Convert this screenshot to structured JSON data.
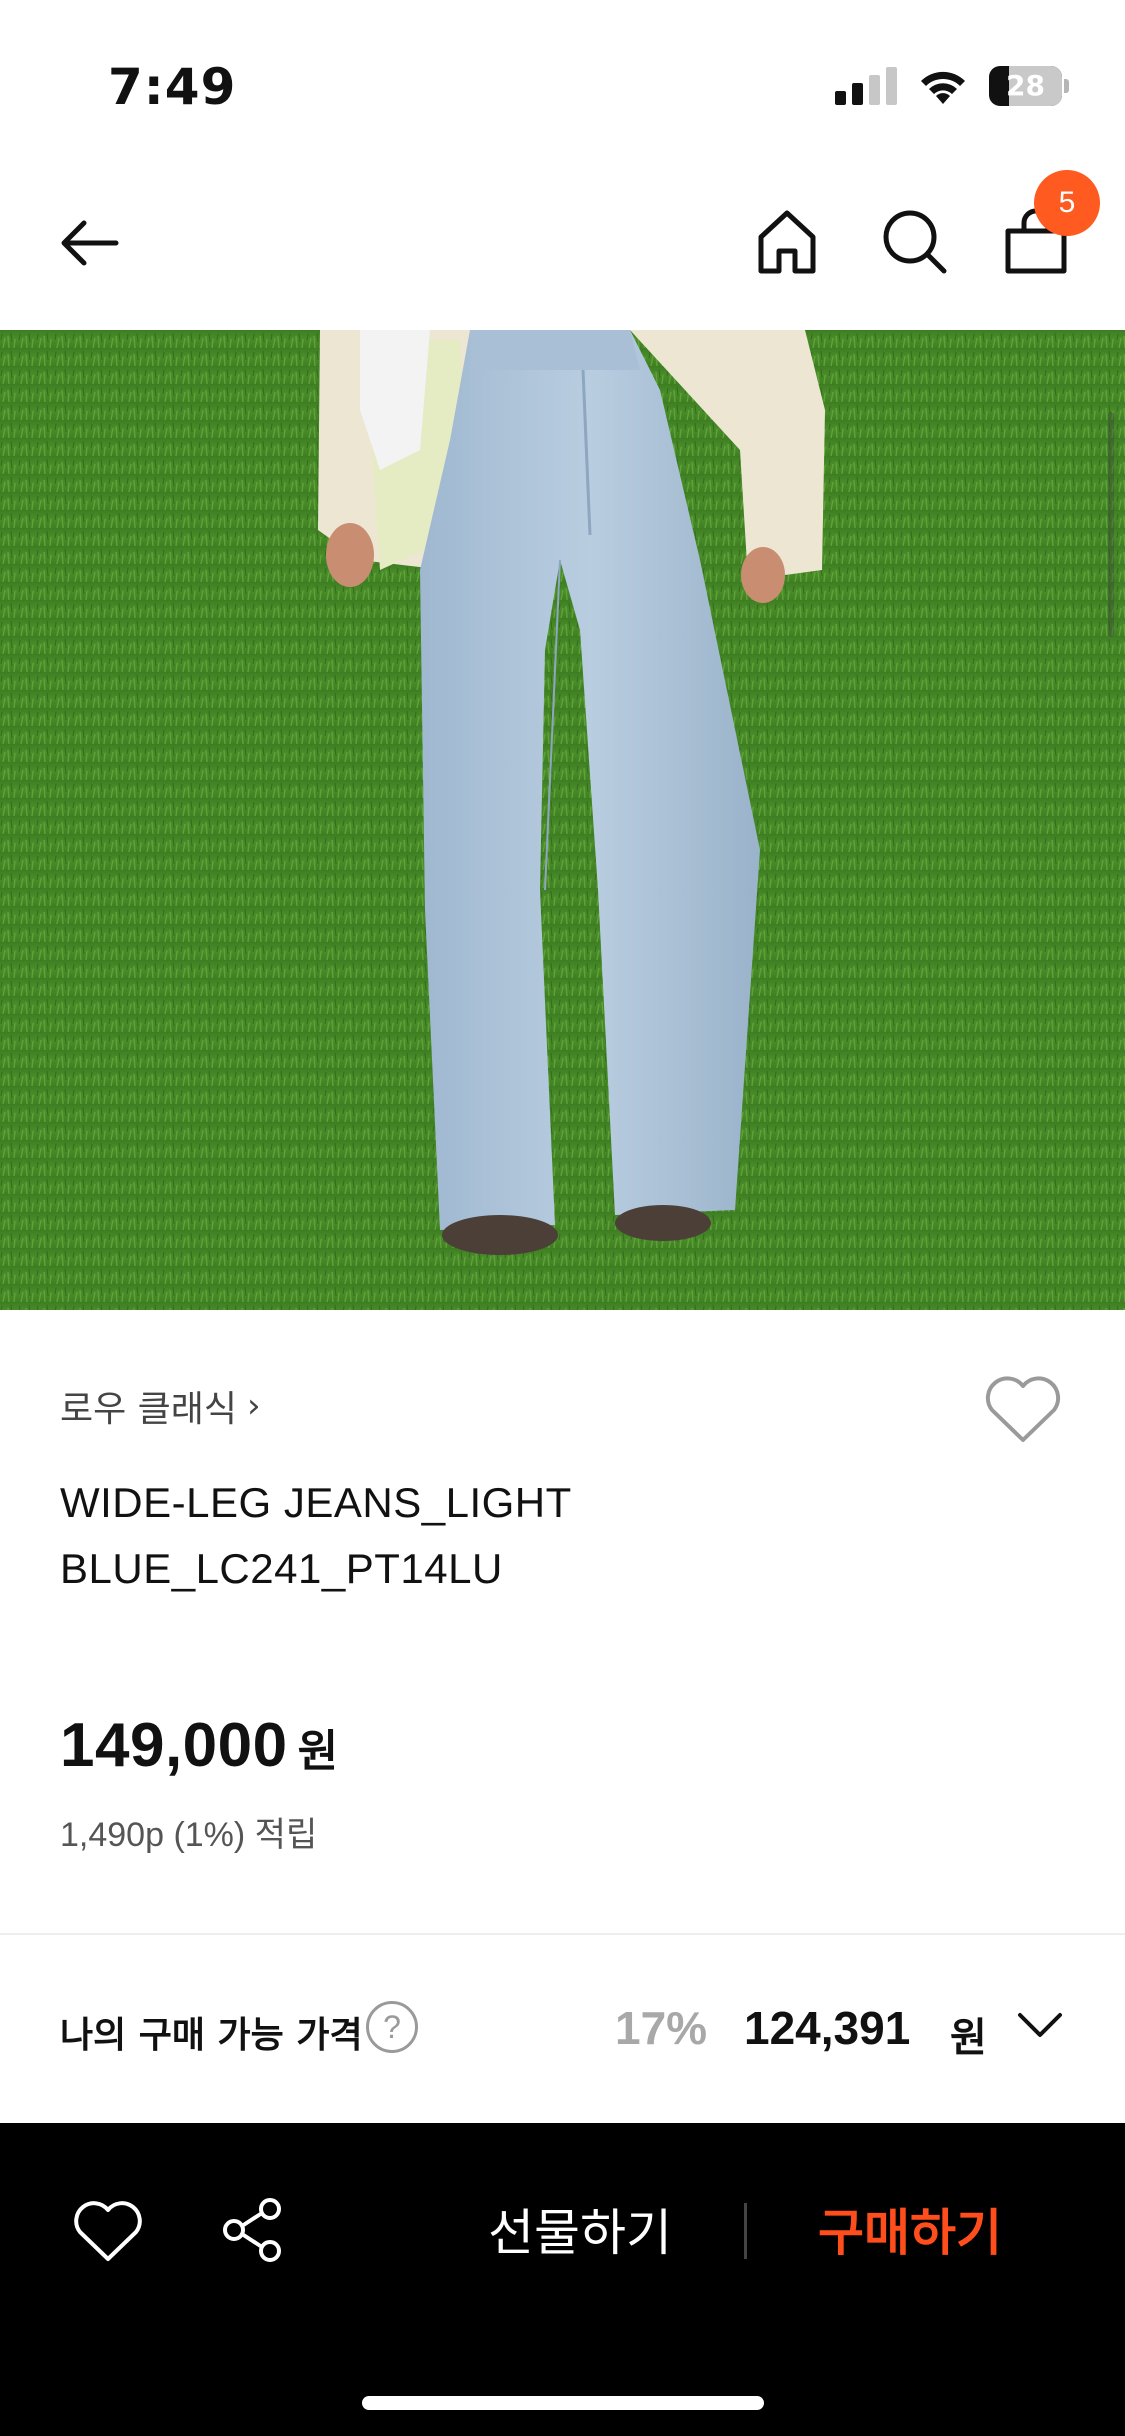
{
  "status_bar": {
    "time": "7:49",
    "battery_percent": "28",
    "battery_level_fraction": 0.28,
    "signal_bars_active": 2,
    "signal_bars_total": 4,
    "icons": [
      "signal-icon",
      "wifi-icon",
      "battery-icon"
    ]
  },
  "nav": {
    "icons": [
      "back-arrow-icon",
      "home-icon",
      "search-icon",
      "shopping-bag-icon"
    ],
    "cart_count": "5"
  },
  "product_image": {
    "description_icon": "product-photo-wide-leg-jeans"
  },
  "product": {
    "brand": "로우 클래식",
    "brand_chevron": "›",
    "title": "WIDE-LEG JEANS_LIGHT BLUE_LC241_PT14LU",
    "price": "149,000",
    "price_unit": "원",
    "points": "1,490p (1%) 적립"
  },
  "buy_price": {
    "label": "나의 구매 가능 가격",
    "help": "?",
    "discount_rate": "17%",
    "final_price": "124,391",
    "final_unit": "원"
  },
  "bottom_bar": {
    "gift_label": "선물하기",
    "buy_label": "구매하기"
  },
  "colors": {
    "accent": "#ff5a1f",
    "buy_text": "#ff4e1b",
    "bottom_bar_bg": "#000000",
    "discount_gray": "#a8a8a8"
  }
}
